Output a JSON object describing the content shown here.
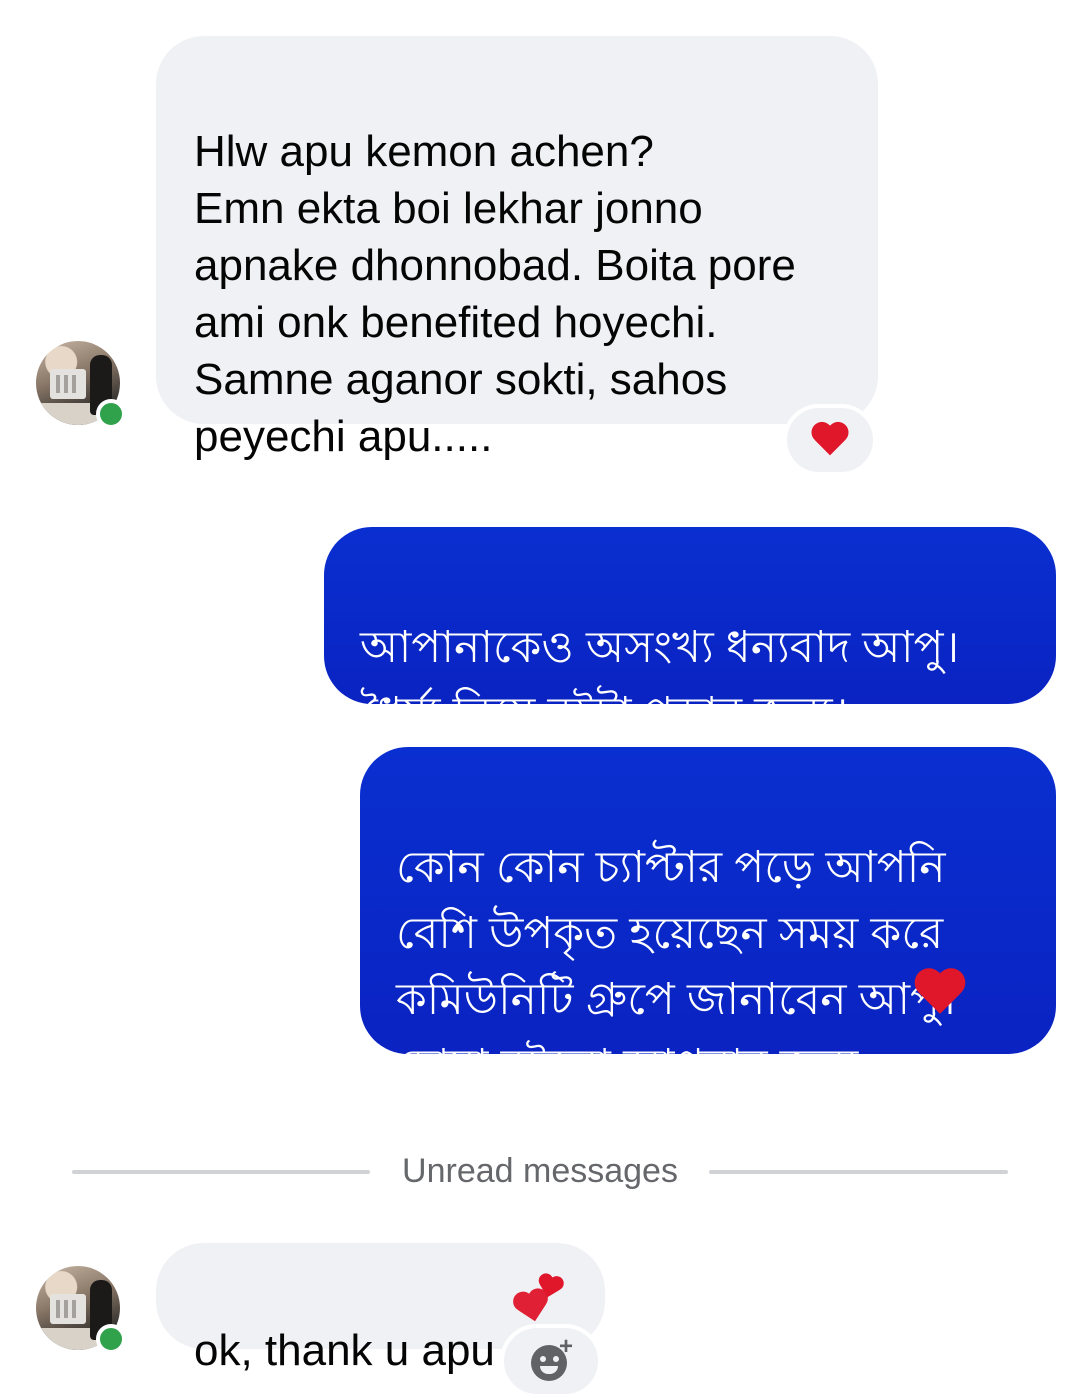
{
  "conversation": {
    "messages": [
      {
        "direction": "incoming",
        "text": "Hlw apu kemon achen?\nEmn ekta boi lekhar jonno apnake dhonnobad. Boita pore ami onk benefited hoyechi. Samne aganor sokti, sahos peyechi apu.....",
        "reaction": "heart"
      },
      {
        "direction": "outgoing",
        "text": "আপানাকেও অসংখ্য ধন্যবাদ আপু।\nধৈর্য্য নিয়ে বইটা পড়ার জন্য।"
      },
      {
        "direction": "outgoing",
        "text": "কোন কোন চ্যাপ্টার পড়ে আপনি\nবেশি উপকৃত হয়েছেন সময় করে\nকমিউনিটি গ্রুপে জানাবেন আপু।\nদোয়া রইলো আপনার জন্য",
        "trailing_emoji": "heart"
      },
      {
        "direction": "incoming",
        "text": "ok, thank u apu",
        "trailing_emoji": "two-hearts"
      }
    ],
    "unread_divider": "Unread messages"
  },
  "colors": {
    "incoming_bubble": "#f0f1f4",
    "outgoing_bubble": "#0a2fd0",
    "online": "#31a24c",
    "heart": "#e0162b"
  },
  "icons": {
    "reaction": "heart-icon",
    "add_reaction": "add-reaction-icon"
  }
}
